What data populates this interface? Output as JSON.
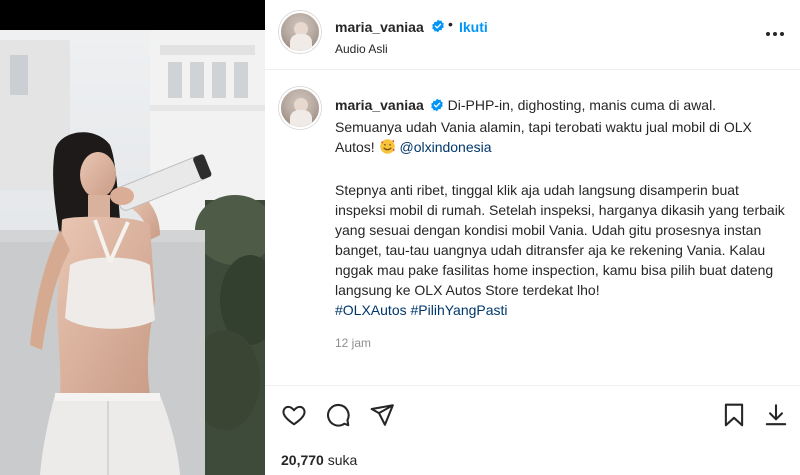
{
  "post": {
    "username": "maria_vaniaa",
    "separator": "•",
    "follow_label": "Ikuti",
    "audio_label": "Audio Asli",
    "caption": {
      "username": "maria_vaniaa",
      "line1": "Di-PHP-in, dighosting, manis cuma di awal. Semuanya udah Vania alamin, tapi terobati waktu jual mobil di OLX Autos!",
      "mention": "@olxindonesia",
      "paragraph2": "Stepnya anti ribet, tinggal klik aja udah langsung disamperin buat inspeksi mobil di rumah. Setelah inspeksi, harganya dikasih yang terbaik yang sesuai dengan kondisi mobil Vania. Udah gitu prosesnya instan banget, tau-tau uangnya udah ditransfer aja ke rekening Vania. Kalau nggak mau pake fasilitas home inspection, kamu bisa pilih buat dateng langsung ke OLX Autos Store terdekat lho!",
      "hashtag1": "#OLXAutos",
      "hashtag2": "#PilihYangPasti"
    },
    "timestamp": "12 jam",
    "likes_count": "20,770",
    "likes_suffix": "suka"
  },
  "icons": {
    "verified": "verified-badge-icon",
    "emoji": "smiling-face-with-hearts-emoji",
    "more": "more-options-icon",
    "like": "heart-icon",
    "comment": "comment-icon",
    "share": "paper-plane-icon",
    "save": "bookmark-icon",
    "download": "download-icon"
  },
  "colors": {
    "link_blue": "#0095f6",
    "hashtag": "#00376b",
    "verified": "#0095f6",
    "muted": "#8e8e8e"
  }
}
